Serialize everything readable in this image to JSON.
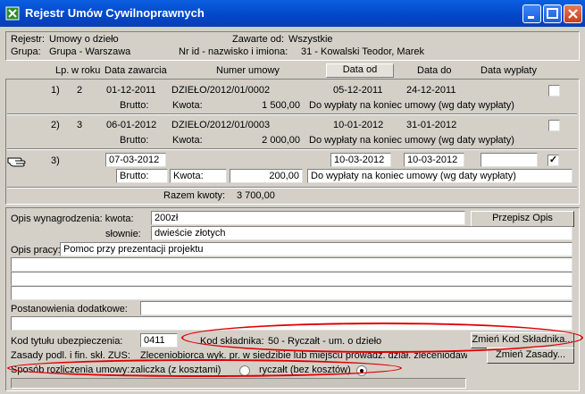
{
  "window": {
    "title": "Rejestr Umów Cywilnoprawnych"
  },
  "header": {
    "rejestr_label": "Rejestr:",
    "rejestr_value": "Umowy o dzieło",
    "grupa_label": "Grupa:",
    "grupa_value": "Grupa - Warszawa",
    "zawarte_label": "Zawarte od:",
    "zawarte_value": "Wszystkie",
    "nrid_label": "Nr id - nazwisko i imiona:",
    "nrid_value": "31 - Kowalski Teodor, Marek"
  },
  "columns": {
    "lp": "Lp.",
    "wroku": "w roku",
    "data_zawarcia": "Data zawarcia",
    "numer_umowy": "Numer umowy",
    "data_od": "Data od",
    "data_do": "Data do",
    "data_wyplaty": "Data wypłaty"
  },
  "rows": [
    {
      "lp": "1)",
      "wroku": "2",
      "data_zawarcia": "01-12-2011",
      "numer": "DZIEŁO/2012/01/0002",
      "data_od": "05-12-2011",
      "data_do": "24-12-2011",
      "checked": false,
      "brutto_label": "Brutto:",
      "kwota_label": "Kwota:",
      "kwota": "1 500,00",
      "wyplata": "Do wypłaty na koniec umowy (wg daty wypłaty)"
    },
    {
      "lp": "2)",
      "wroku": "3",
      "data_zawarcia": "06-01-2012",
      "numer": "DZIEŁO/2012/01/0003",
      "data_od": "10-01-2012",
      "data_do": "31-01-2012",
      "checked": false,
      "brutto_label": "Brutto:",
      "kwota_label": "Kwota:",
      "kwota": "2 000,00",
      "wyplata": "Do wypłaty na koniec umowy (wg daty wypłaty)"
    },
    {
      "lp": "3)",
      "wroku": "",
      "data_zawarcia": "07-03-2012",
      "numer": "",
      "data_od": "10-03-2012",
      "data_do": "10-03-2012",
      "checked": true,
      "brutto_label": "Brutto:",
      "kwota_label": "Kwota:",
      "kwota": "200,00",
      "wyplata": "Do wypłaty na koniec umowy (wg daty wypłaty)"
    }
  ],
  "summary": {
    "label": "Razem kwoty:",
    "value": "3 700,00"
  },
  "form": {
    "opis_label": "Opis wynagrodzenia: kwota:",
    "opis_kwota": "200zł",
    "slownie_label": "słownie:",
    "slownie_value": "dwieście złotych",
    "przepisz_button": "Przepisz Opis Umowy...",
    "opis_pracy_label": "Opis pracy:",
    "opis_pracy_value": "Pomoc przy prezentacji projektu",
    "postanowienia_label": "Postanowienia dodatkowe:",
    "kod_tytulu_label": "Kod tytułu ubezpieczenia:",
    "kod_tytulu_value": "0411",
    "kod_skladnika_label": "Kod składnika:",
    "kod_skladnika_value": "50 - Ryczałt - um. o dzieło",
    "zmien_kod_button": "Zmień Kod Składnika...",
    "zasady_label": "Zasady podl. i fin. skł. ZUS:",
    "zasady_value": "Zleceniobiorca wyk. pr. w siedzibie lub miejscu prowadz. dział. zleceniodaw",
    "zmien_zasady_button": "Zmień Zasady...",
    "sposob_label": "Sposób rozliczenia umowy:",
    "opt_zaliczka": "zaliczka (z kosztami)",
    "opt_zaliczka_selected": false,
    "opt_ryczalt": "ryczałt (bez kosztów)",
    "opt_ryczalt_selected": true
  },
  "colors": {
    "titlebar": "#0346c8",
    "annotation": "#e00000",
    "background": "#d4d0c8"
  }
}
